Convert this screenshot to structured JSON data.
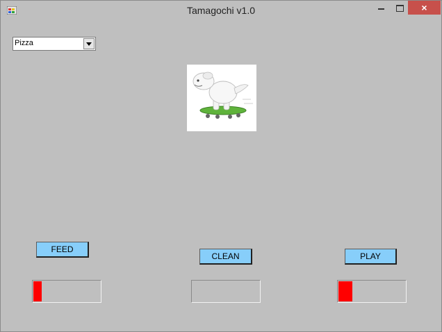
{
  "window": {
    "title": "Tamagochi v1.0",
    "close_glyph": "×"
  },
  "food_select": {
    "selected": "Pizza"
  },
  "pet_image": {
    "icon": "dog-on-skateboard-image"
  },
  "buttons": {
    "feed": "FEED",
    "clean": "CLEAN",
    "play": "PLAY"
  },
  "meters": {
    "hunger": {
      "level": 0.12,
      "color": "#ff0000"
    },
    "clean": {
      "level": 0.0,
      "color": "#ff0000"
    },
    "play": {
      "level": 0.21,
      "color": "#ff0000"
    }
  },
  "colors": {
    "button": "#87cefa",
    "background": "#bfbfbf",
    "close": "#c7504b"
  }
}
